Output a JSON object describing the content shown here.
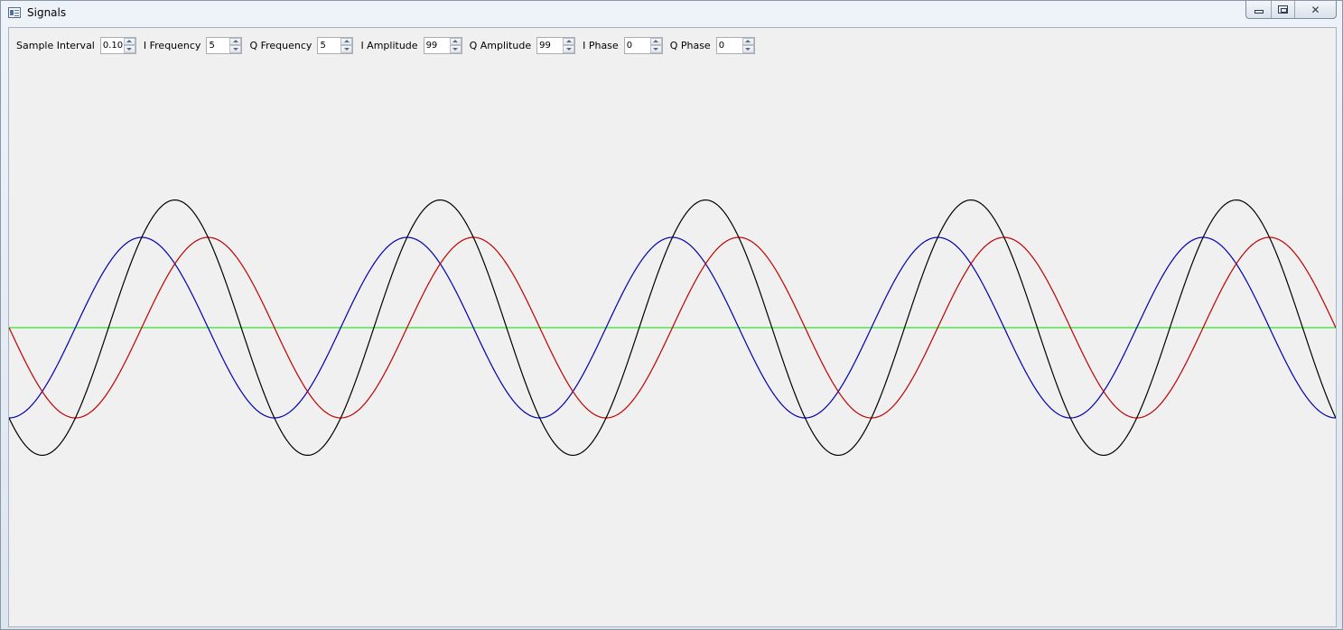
{
  "window": {
    "title": "Signals",
    "icon": "app-window-icon",
    "buttons": {
      "minimize": "minimize-icon",
      "maximize": "maximize-icon",
      "close_glyph": "✕"
    }
  },
  "controls": [
    {
      "label": "Sample Interval",
      "value": "0.10"
    },
    {
      "label": "I Frequency",
      "value": "5"
    },
    {
      "label": "Q Frequency",
      "value": "5"
    },
    {
      "label": "I Amplitude",
      "value": "99"
    },
    {
      "label": "Q Amplitude",
      "value": "99"
    },
    {
      "label": "I Phase",
      "value": "0"
    },
    {
      "label": "Q Phase",
      "value": "0"
    }
  ],
  "plot": {
    "cycles": 5,
    "colors": {
      "i_signal": "#0000b0",
      "q_signal": "#c00000",
      "sum_signal": "#000000",
      "axis": "#00dd00",
      "background": "#f0f0f0"
    }
  }
}
